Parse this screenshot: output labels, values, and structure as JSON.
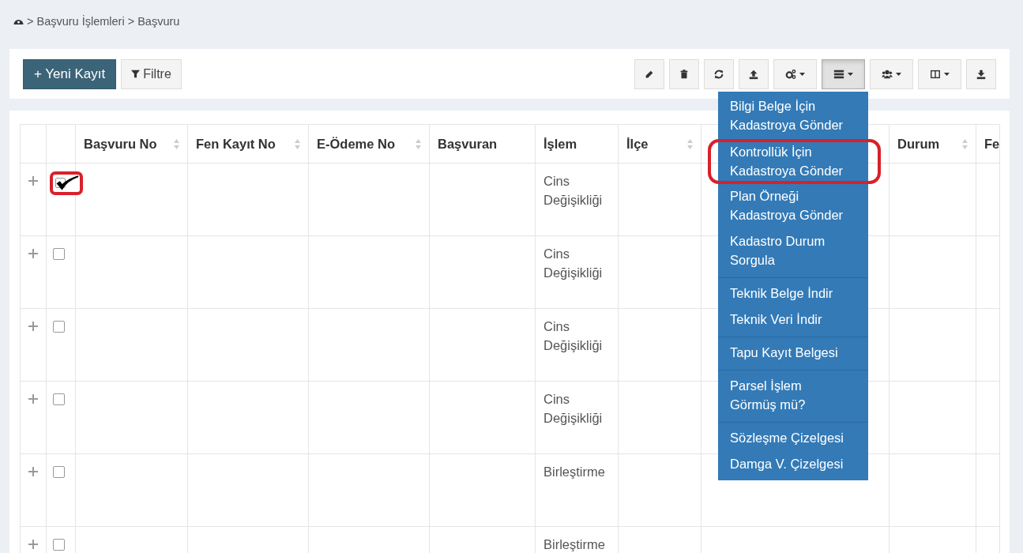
{
  "breadcrumb": {
    "items": [
      "Başvuru İşlemleri",
      "Başvuru"
    ],
    "separator": ">"
  },
  "toolbar": {
    "primary_button": "+ Yeni Kayıt",
    "filter_button": "Filtre",
    "actions": [
      {
        "kind": "plain",
        "expanded": false
      },
      {
        "kind": "plain",
        "expanded": false
      },
      {
        "kind": "plain",
        "expanded": false
      },
      {
        "kind": "plain",
        "expanded": false
      },
      {
        "kind": "dropdown",
        "expanded": false
      },
      {
        "kind": "dropdown",
        "expanded": true
      },
      {
        "kind": "dropdown",
        "expanded": false
      },
      {
        "kind": "dropdown",
        "expanded": false
      },
      {
        "kind": "plain",
        "expanded": false
      }
    ]
  },
  "menu": {
    "groups": [
      [
        {
          "label": "Bilgi Belge İçin Kadastroya Gönder",
          "circled": false
        },
        {
          "label": "Kontrollük İçin Kadastroya Gönder",
          "circled": true
        },
        {
          "label": "Plan Örneği Kadastroya Gönder",
          "circled": false
        },
        {
          "label": "Kadastro Durum Sorgula",
          "circled": false
        }
      ],
      [
        {
          "label": "Teknik Belge İndir",
          "circled": false
        },
        {
          "label": "Teknik Veri İndir",
          "circled": false
        }
      ],
      [
        {
          "label": "Tapu Kayıt Belgesi",
          "circled": false
        }
      ],
      [
        {
          "label": "Parsel İşlem Görmüş mü?",
          "circled": false
        }
      ],
      [
        {
          "label": "Sözleşme Çizelgesi",
          "circled": false
        },
        {
          "label": "Damga V. Çizelgesi",
          "circled": false
        }
      ]
    ]
  },
  "table": {
    "columns": [
      {
        "label": "Başvuru No",
        "sortable": true
      },
      {
        "label": "Fen Kayıt No",
        "sortable": true
      },
      {
        "label": "E-Ödeme No",
        "sortable": true
      },
      {
        "label": "Başvuran",
        "sortable": false
      },
      {
        "label": "İşlem",
        "sortable": false
      },
      {
        "label": "İlçe",
        "sortable": true
      },
      {
        "sortable": false
      },
      {
        "label": "Durum",
        "sortable": true
      },
      {
        "label": "Fe",
        "sortable": false
      }
    ],
    "rows": [
      {
        "checked": true,
        "circled": true,
        "islem": "Cins Değişikliği"
      },
      {
        "checked": false,
        "circled": false,
        "islem": "Cins Değişikliği"
      },
      {
        "checked": false,
        "circled": false,
        "islem": "Cins Değişikliği"
      },
      {
        "checked": false,
        "circled": false,
        "islem": "Cins Değişikliği"
      },
      {
        "checked": false,
        "circled": false,
        "islem": "Birleştirme"
      },
      {
        "checked": false,
        "circled": false,
        "islem": "Birleştirme"
      }
    ]
  }
}
